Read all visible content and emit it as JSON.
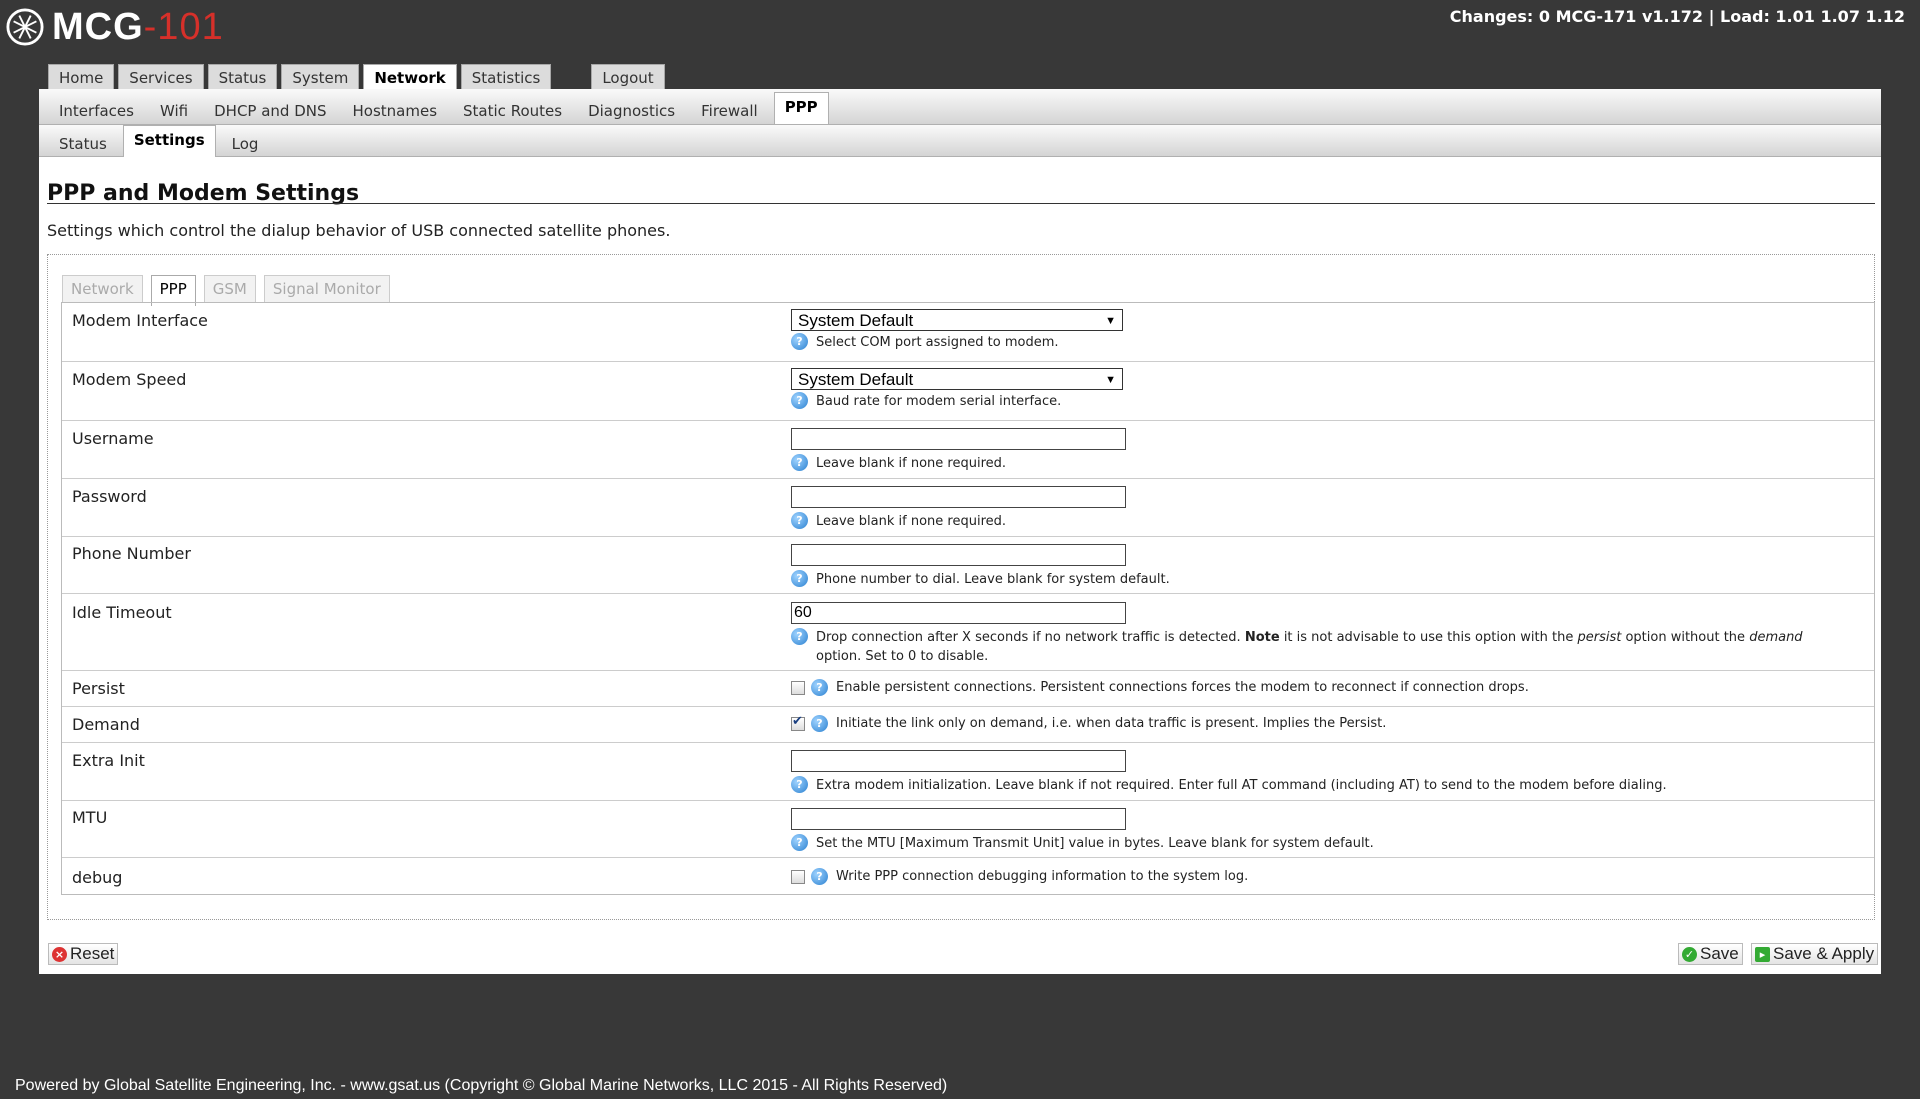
{
  "header": {
    "logo_text": "MCG",
    "logo_number": "-101",
    "status": "Changes: 0   MCG-171 v1.172 | Load: 1.01 1.07 1.12"
  },
  "main_tabs": [
    {
      "label": "Home"
    },
    {
      "label": "Services"
    },
    {
      "label": "Status"
    },
    {
      "label": "System"
    },
    {
      "label": "Network"
    },
    {
      "label": "Statistics"
    },
    {
      "label": "Logout"
    }
  ],
  "network_tabs": [
    {
      "label": "Interfaces"
    },
    {
      "label": "Wifi"
    },
    {
      "label": "DHCP and DNS"
    },
    {
      "label": "Hostnames"
    },
    {
      "label": "Static Routes"
    },
    {
      "label": "Diagnostics"
    },
    {
      "label": "Firewall"
    },
    {
      "label": "PPP"
    }
  ],
  "ppp_tabs": [
    {
      "label": "Status"
    },
    {
      "label": "Settings"
    },
    {
      "label": "Log"
    }
  ],
  "page": {
    "title": "PPP and Modem Settings",
    "description": "Settings which control the dialup behavior of USB connected satellite phones."
  },
  "section_tabs": [
    {
      "label": "Network"
    },
    {
      "label": "PPP"
    },
    {
      "label": "GSM"
    },
    {
      "label": "Signal Monitor"
    }
  ],
  "fields": {
    "modem_interface": {
      "label": "Modem Interface",
      "value": "System Default",
      "help": "Select COM port assigned to modem."
    },
    "modem_speed": {
      "label": "Modem Speed",
      "value": "System Default",
      "help": "Baud rate for modem serial interface."
    },
    "username": {
      "label": "Username",
      "value": "",
      "help": "Leave blank if none required."
    },
    "password": {
      "label": "Password",
      "value": "",
      "help": "Leave blank if none required."
    },
    "phone_number": {
      "label": "Phone Number",
      "value": "",
      "help": "Phone number to dial. Leave blank for system default."
    },
    "idle_timeout": {
      "label": "Idle Timeout",
      "value": "60",
      "help_1": "Drop connection after X seconds if no network traffic is detected.",
      "help_note": "Note",
      "help_2": "it is not advisable to use this option with the",
      "help_persist": "persist",
      "help_3": "option without the",
      "help_demand": "demand",
      "help_4": "option. Set to 0 to disable."
    },
    "persist": {
      "label": "Persist",
      "checked": false,
      "help": "Enable persistent connections. Persistent connections forces the modem to reconnect if connection drops."
    },
    "demand": {
      "label": "Demand",
      "checked": true,
      "help": "Initiate the link only on demand, i.e. when data traffic is present. Implies the Persist."
    },
    "extra_init": {
      "label": "Extra Init",
      "value": "",
      "help": "Extra modem initialization. Leave blank if not required. Enter full AT command (including AT) to send to the modem before dialing."
    },
    "mtu": {
      "label": "MTU",
      "value": "",
      "help": "Set the MTU [Maximum Transmit Unit] value in bytes. Leave blank for system default."
    },
    "debug": {
      "label": "debug",
      "checked": false,
      "help": "Write PPP connection debugging information to the system log."
    }
  },
  "actions": {
    "reset": "Reset",
    "save": "Save",
    "save_apply": "Save & Apply"
  },
  "footer": "Powered by Global Satellite Engineering, Inc. - www.gsat.us (Copyright © Global Marine Networks, LLC 2015 - All Rights Reserved)",
  "help_glyph": "?"
}
